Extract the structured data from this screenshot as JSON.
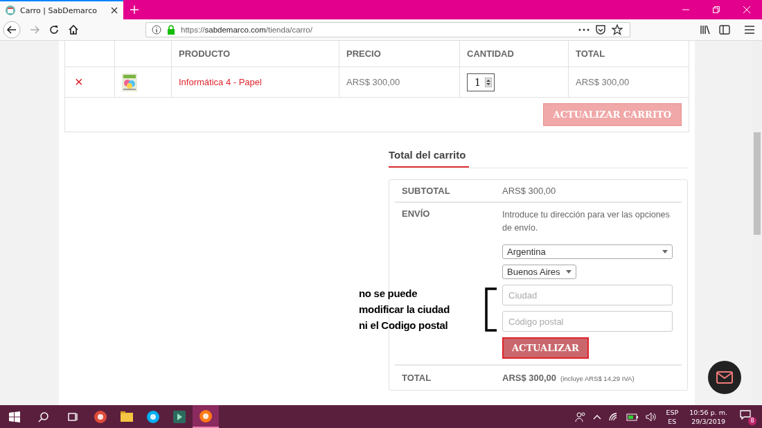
{
  "browser": {
    "tab": {
      "title": "Carro | SabDemarco",
      "selected": true
    },
    "url": {
      "scheme": "https://",
      "host": "sabdemarco.com",
      "path": "/tienda/carro/"
    }
  },
  "cart": {
    "columns": [
      "PRODUCTO",
      "PRECIO",
      "CANTIDAD",
      "TOTAL"
    ],
    "rows": [
      {
        "remove": "×",
        "product": "Informática 4 - Papel",
        "price": "ARS$ 300,00",
        "quantity": "1",
        "total": "ARS$ 300,00"
      }
    ],
    "update_button": {
      "label": "ACTUALIZAR CARRITO",
      "disabled": true
    }
  },
  "totals": {
    "heading": "Total del carrito",
    "subtotal": {
      "label": "SUBTOTAL",
      "value": "ARS$ 300,00"
    },
    "shipping": {
      "label": "ENVÍO",
      "text": "Introduce tu dirección para ver las opciones de envío.",
      "country": "Argentina",
      "state": "Buenos Aires",
      "city_placeholder": "Ciudad",
      "postcode_placeholder": "Código postal",
      "button": "ACTUALIZAR"
    },
    "total": {
      "label": "TOTAL",
      "value": "ARS$ 300,00",
      "note": "(incluye ARS$ 14,29  IVA)"
    }
  },
  "annotation": [
    "no se puede",
    "modificar la ciudad",
    "ni el Codigo postal"
  ],
  "taskbar": {
    "apps": [
      {
        "kind": "chrome",
        "selected": false
      },
      {
        "kind": "folder",
        "selected": false
      },
      {
        "kind": "skype",
        "selected": false
      },
      {
        "kind": "editor",
        "selected": false
      },
      {
        "kind": "firefox",
        "selected": true
      }
    ],
    "language": [
      "ESP",
      "ES"
    ],
    "time": "10:56 p. m.",
    "date": "29/3/2019",
    "notifications": "8"
  }
}
